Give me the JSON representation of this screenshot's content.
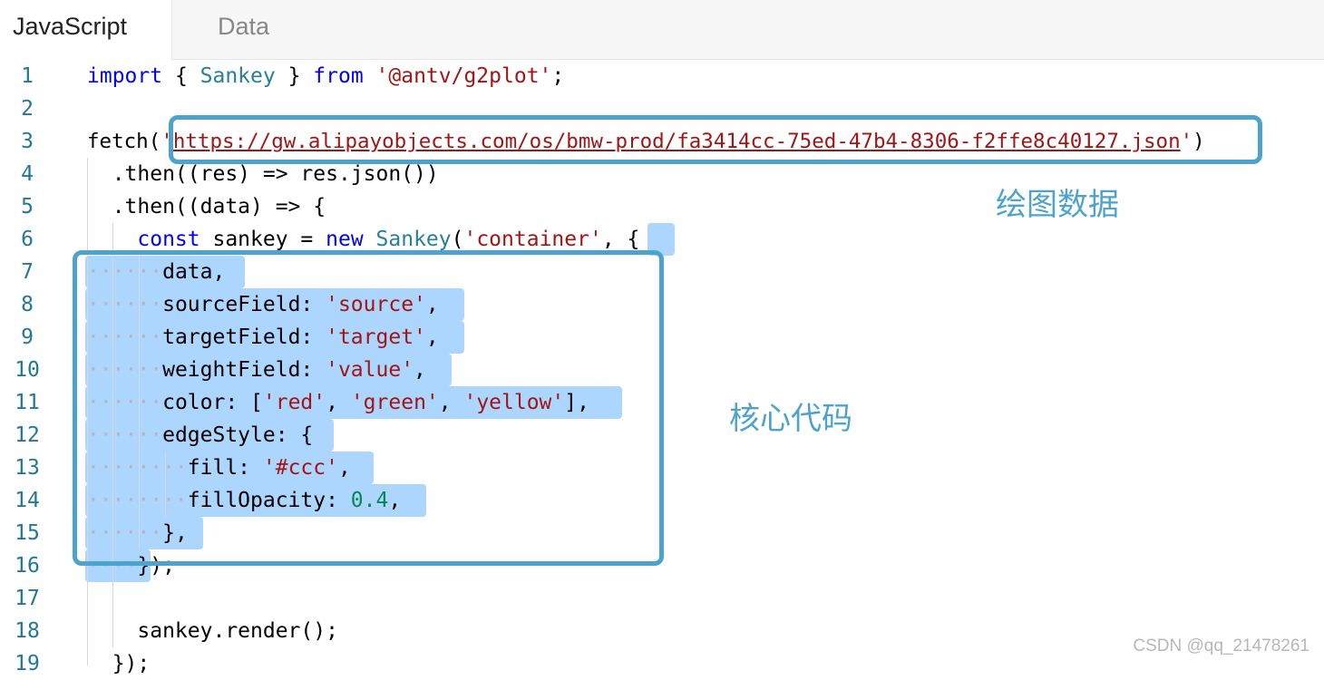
{
  "tabs": [
    {
      "label": "JavaScript",
      "active": true
    },
    {
      "label": "Data",
      "active": false
    }
  ],
  "line_numbers": [
    "1",
    "2",
    "3",
    "4",
    "5",
    "6",
    "7",
    "8",
    "9",
    "10",
    "11",
    "12",
    "13",
    "14",
    "15",
    "16",
    "17",
    "18",
    "19"
  ],
  "code": {
    "l1": {
      "import_kw": "import",
      "brace_open": " { ",
      "cls": "Sankey",
      "brace_close": " } ",
      "from_kw": "from",
      "space": " ",
      "module": "'@antv/g2plot'",
      "semi": ";"
    },
    "l3": {
      "fetch": "fetch(",
      "url_quote_open": "'",
      "url": "https://gw.alipayobjects.com/os/bmw-prod/fa3414cc-75ed-47b4-8306-f2ffe8c40127.json",
      "url_quote_close": "'",
      "close": ")"
    },
    "l4": "  .then((res) => res.json())",
    "l5": "  .then((data) => {",
    "l6": {
      "indent": "    ",
      "const_kw": "const",
      "mid": " sankey = ",
      "new_kw": "new",
      "space": " ",
      "cls": "Sankey",
      "paren": "(",
      "arg": "'container'",
      "tail": ", {"
    },
    "l7": "data,",
    "l8": {
      "key": "sourceField: ",
      "val": "'source'",
      "tail": ","
    },
    "l9": {
      "key": "targetField: ",
      "val": "'target'",
      "tail": ","
    },
    "l10": {
      "key": "weightField: ",
      "val": "'value'",
      "tail": ","
    },
    "l11": {
      "key": "color: [",
      "v1": "'red'",
      "sep1": ", ",
      "v2": "'green'",
      "sep2": ", ",
      "v3": "'yellow'",
      "tail": "],"
    },
    "l12": "edgeStyle: {",
    "l13": {
      "key": "fill: ",
      "val": "'#ccc'",
      "tail": ","
    },
    "l14": {
      "key": "fillOpacity: ",
      "val": "0.4",
      "tail": ","
    },
    "l15": "},",
    "l16": "});",
    "l18": "sankey.render();",
    "l19": "});"
  },
  "annotations": {
    "data_label": "绘图数据",
    "core_label": "核心代码"
  },
  "watermark": "CSDN @qq_21478261",
  "colors": {
    "keyword": "#0000ff",
    "string": "#a31515",
    "class": "#267f99",
    "number": "#098658",
    "line_number": "#237893",
    "selection": "#add6ff",
    "annotation": "#4ea3cc"
  }
}
